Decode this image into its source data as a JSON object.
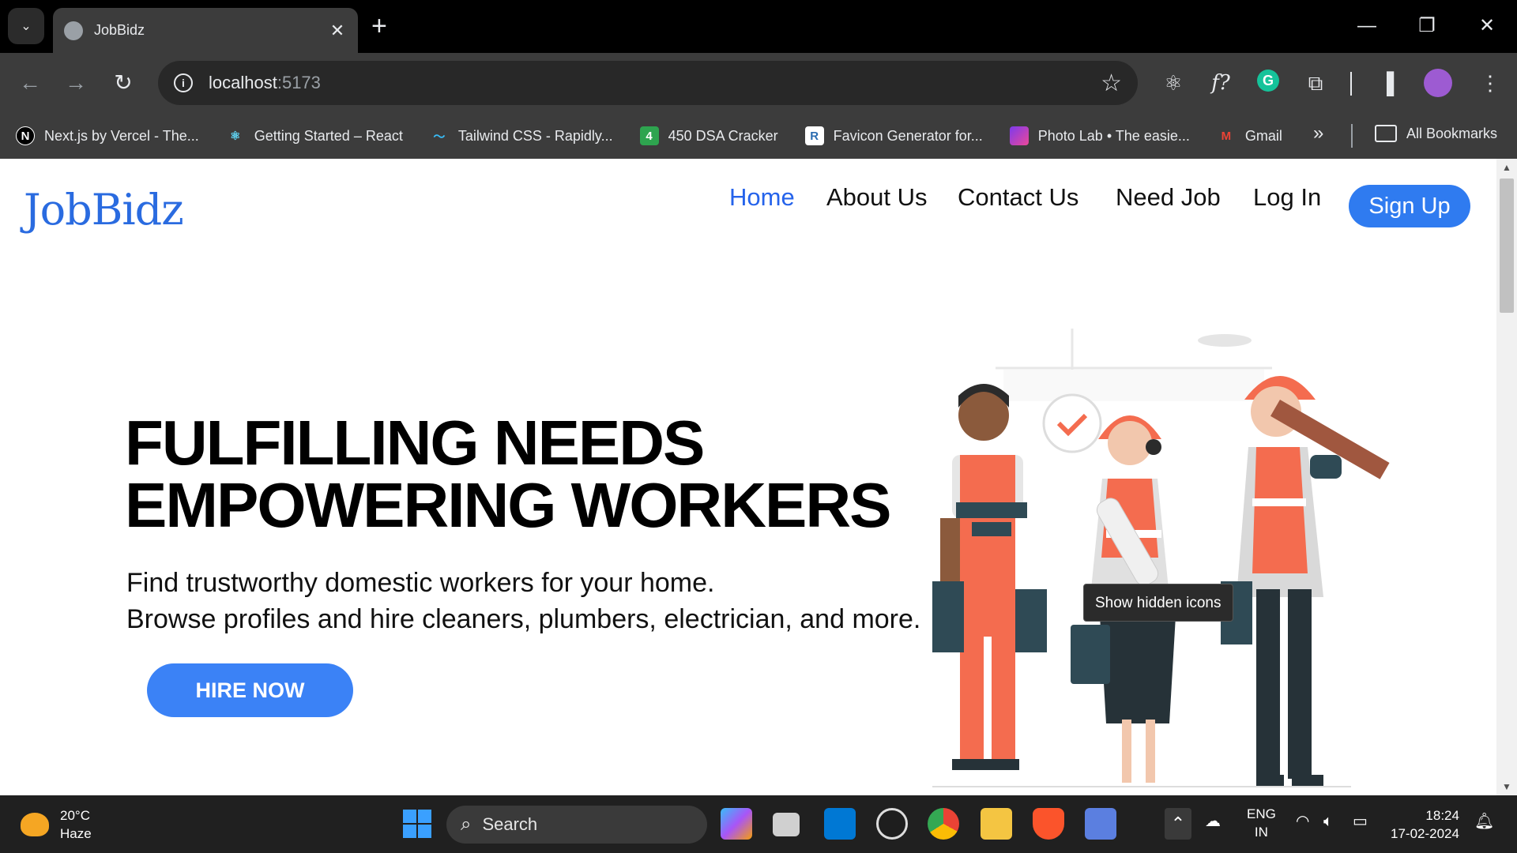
{
  "browser": {
    "tab_title": "JobBidz",
    "url_host": "localhost",
    "url_port": ":5173",
    "bookmarks": [
      {
        "label": "Next.js by Vercel - The...",
        "icon": "nextjs-icon",
        "color": "#000000",
        "glyph": "N"
      },
      {
        "label": "Getting Started – React",
        "icon": "react-icon",
        "color": "#61dafb",
        "glyph": "⚛"
      },
      {
        "label": "Tailwind CSS - Rapidly...",
        "icon": "tailwind-icon",
        "color": "#38bdf8",
        "glyph": "〜"
      },
      {
        "label": "450 DSA Cracker",
        "icon": "dsa-icon",
        "color": "#2ea44f",
        "glyph": "4"
      },
      {
        "label": "Favicon Generator for...",
        "icon": "favicon-icon",
        "color": "#2b6cb0",
        "glyph": "R"
      },
      {
        "label": "Photo Lab • The easie...",
        "icon": "photolab-icon",
        "color": "#c026d3",
        "glyph": ""
      },
      {
        "label": "Gmail",
        "icon": "gmail-icon",
        "color": "#ea4335",
        "glyph": "M"
      }
    ],
    "all_bookmarks": "All Bookmarks"
  },
  "page": {
    "logo": "JobBidz",
    "nav": [
      "Home",
      "About Us",
      "Contact Us",
      "Need Job",
      "Log In"
    ],
    "signup": "Sign Up",
    "hero_line1": "FULFILLING NEEDS",
    "hero_line2": "EMPOWERING WORKERS",
    "sub_line1": "Find trustworthy domestic workers for your home.",
    "sub_line2": "Browse profiles and hire cleaners, plumbers, electrician, and more.",
    "cta": "HIRE NOW",
    "colors": {
      "brand": "#2a6be0",
      "cta": "#3b82f6",
      "orange": "#f46c4f"
    }
  },
  "tooltip": "Show hidden icons",
  "taskbar": {
    "temp": "20°C",
    "weather": "Haze",
    "search": "Search",
    "lang1": "ENG",
    "lang2": "IN",
    "time": "18:24",
    "date": "17-02-2024"
  }
}
